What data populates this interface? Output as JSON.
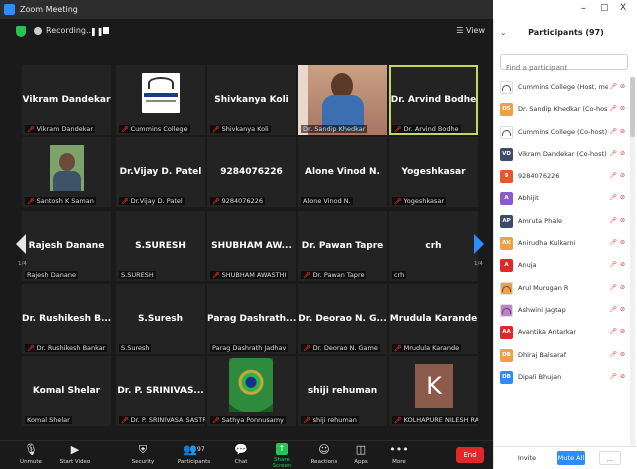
{
  "window": {
    "title": "Zoom Meeting",
    "controls": {
      "minimize": "–",
      "maximize": "▢",
      "close": "X"
    }
  },
  "meeting_bar": {
    "recording_label": "Recording...",
    "view_label": "View"
  },
  "grid": {
    "page_left": "1/4",
    "page_right": "1/4",
    "tiles": [
      {
        "name": "Vikram Dandekar",
        "label": "Vikram Dandekar",
        "muted": true
      },
      {
        "name": "",
        "label": "Cummins College",
        "muted": true,
        "image": "cummins-logo"
      },
      {
        "name": "Shivkanya Koli",
        "label": "Shivkanya Koli",
        "muted": true
      },
      {
        "name": "",
        "label": "Dr. Sandip Khedkar",
        "muted": false,
        "image": "video-person"
      },
      {
        "name": "Dr. Arvind Bodhe",
        "label": "Dr. Arvind Bodhe",
        "muted": true,
        "active": true
      },
      {
        "name": "",
        "label": "Santosh K Saman",
        "muted": true,
        "image": "profile-photo"
      },
      {
        "name": "Dr.Vijay D. Patel",
        "label": "Dr.Vijay D. Patel",
        "muted": true
      },
      {
        "name": "9284076226",
        "label": "9284076226",
        "muted": true
      },
      {
        "name": "Alone Vinod N.",
        "label": "Alone Vinod N.",
        "muted": false
      },
      {
        "name": "Yogeshkasar",
        "label": "Yogeshkasar",
        "muted": true
      },
      {
        "name": "Rajesh Danane",
        "label": "Rajesh Danane",
        "muted": false
      },
      {
        "name": "S.SURESH",
        "label": "S.SURESH",
        "muted": false
      },
      {
        "name": "SHUBHAM AW...",
        "label": "SHUBHAM AWASTHI",
        "muted": true
      },
      {
        "name": "Dr. Pawan Tapre",
        "label": "Dr. Pawan Tapre",
        "muted": true
      },
      {
        "name": "crh",
        "label": "crh",
        "muted": false
      },
      {
        "name": "Dr. Rushikesh B...",
        "label": "Dr. Rushikesh Bankar",
        "muted": true
      },
      {
        "name": "S.Suresh",
        "label": "S.Suresh",
        "muted": false
      },
      {
        "name": "Parag Dashrath...",
        "label": "Parag Dashrath Jadhav",
        "muted": false
      },
      {
        "name": "Dr. Deorao N. G...",
        "label": "Dr. Deorao N. Game",
        "muted": true
      },
      {
        "name": "Mrudula Karande",
        "label": "Mrudula Karande",
        "muted": true
      },
      {
        "name": "Komal Shelar",
        "label": "Komal Shelar",
        "muted": false
      },
      {
        "name": "Dr. P. SRINIVAS...",
        "label": "Dr. P. SRINIVASA SASTRY",
        "muted": true
      },
      {
        "name": "",
        "label": "Sathya Ponnusamy",
        "muted": true,
        "image": "peacock-feather"
      },
      {
        "name": "shiji rehuman",
        "label": "shiji rehuman",
        "muted": true
      },
      {
        "name": "K",
        "label": "KOLHAPURE NILESH RAME...",
        "muted": true,
        "image": "letter-avatar"
      }
    ]
  },
  "toolbar": {
    "unmute": "Unmute",
    "start_video": "Start Video",
    "security": "Security",
    "participants": "Participants",
    "participants_count": "97",
    "chat": "Chat",
    "share_screen": "Share Screen",
    "reactions": "Reactions",
    "apps": "Apps",
    "more": "More",
    "end": "End"
  },
  "participants_panel": {
    "title": "Participants (97)",
    "search_placeholder": "Find a participant",
    "items": [
      {
        "name": "Cummins College (Host, me)",
        "initials": "",
        "color": "#ffffff"
      },
      {
        "name": "Dr. Sandip Khedkar (Co-host)",
        "initials": "DS",
        "color": "#f0a040"
      },
      {
        "name": "Cummins College (Co-host)",
        "initials": "",
        "color": "#ffffff"
      },
      {
        "name": "Vikram Dandekar (Co-host)",
        "initials": "VD",
        "color": "#3d4a6b"
      },
      {
        "name": "9284076226",
        "initials": "9",
        "color": "#e8562a"
      },
      {
        "name": "Abhijit",
        "initials": "A",
        "color": "#8a5cc8"
      },
      {
        "name": "Amruta Phale",
        "initials": "AP",
        "color": "#3d4a6b"
      },
      {
        "name": "Anirudha Kulkarni",
        "initials": "AK",
        "color": "#f0a040"
      },
      {
        "name": "Anuja",
        "initials": "A",
        "color": "#e02828"
      },
      {
        "name": "Arul Murugan R",
        "initials": "",
        "color": "#f0a040"
      },
      {
        "name": "Ashwini Jagtap",
        "initials": "",
        "color": "#c080d0"
      },
      {
        "name": "Avantika Antarkar",
        "initials": "AA",
        "color": "#e02828"
      },
      {
        "name": "Dhiraj Balsaraf",
        "initials": "DB",
        "color": "#f0a040"
      },
      {
        "name": "Dipali Bhujan",
        "initials": "DB",
        "color": "#2d8cff"
      }
    ],
    "footer": {
      "invite": "Invite",
      "mute_all": "Mute All",
      "more": "..."
    }
  }
}
